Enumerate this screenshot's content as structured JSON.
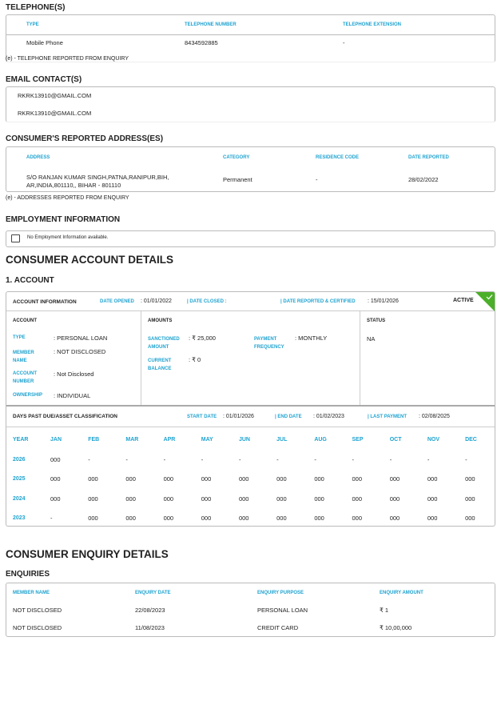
{
  "telephones": {
    "title": "TELEPHONE(S)",
    "headers": [
      "TYPE",
      "TELEPHONE NUMBER",
      "TELEPHONE EXTENSION"
    ],
    "rows": [
      [
        "Mobile Phone",
        "8434592885",
        "-"
      ]
    ],
    "note": "(e) - TELEPHONE REPORTED FROM ENQUIRY"
  },
  "emails": {
    "title": "EMAIL CONTACT(S)",
    "items": [
      "RKRK13910@GMAIL.COM",
      "RKRK13910@GMAIL.COM"
    ]
  },
  "addresses": {
    "title": "CONSUMER'S REPORTED ADDRESS(ES)",
    "headers": [
      "ADDRESS",
      "CATEGORY",
      "RESIDENCE CODE",
      "DATE REPORTED"
    ],
    "rows": [
      [
        "S/O RANJAN KUMAR SINGH,PATNA,RANIPUR,BIH, AR,INDIA,801110,, BIHAR - 801110",
        "Permanent",
        "-",
        "28/02/2022"
      ]
    ],
    "note": "(e) - ADDRESSES REPORTED FROM ENQUIRY"
  },
  "employment": {
    "title": "EMPLOYMENT INFORMATION",
    "message": "No Employment Information available.",
    "icon": "briefcase-info-icon"
  },
  "account_details": {
    "title": "CONSUMER ACCOUNT DETAILS",
    "account_title": "1. ACCOUNT",
    "info": {
      "label": "ACCOUNT INFORMATION",
      "date_opened_label": "DATE OPENED",
      "date_opened": ": 01/01/2022",
      "date_closed_label": "DATE CLOSED",
      "date_closed": ":",
      "date_reported_label": "DATE REPORTED & CERTIFIED",
      "date_reported": ": 15/01/2026",
      "status_badge": "ACTIVE",
      "badge_color": "#4caf2a"
    },
    "account": {
      "heading": "ACCOUNT",
      "type_label": "TYPE",
      "type": "PERSONAL LOAN",
      "member_label": "MEMBER NAME",
      "member": "NOT DISCLOSED",
      "number_label": "ACCOUNT NUMBER",
      "number": "Not Disclosed",
      "ownership_label": "OWNERSHIP",
      "ownership": "INDIVIDUAL"
    },
    "amounts": {
      "heading": "AMOUNTS",
      "sanctioned_label": "SANCTIONED AMOUNT",
      "sanctioned": "₹ 25,000",
      "frequency_label": "PAYMENT FREQUENCY",
      "frequency": "MONTHLY",
      "balance_label": "CURRENT BALANCE",
      "balance": "₹ 0"
    },
    "status": {
      "heading": "STATUS",
      "value": "NA"
    },
    "dpd": {
      "heading": "DAYS PAST DUE/ASSET CLASSIFICATION",
      "start_label": "START DATE",
      "start": ": 01/01/2026",
      "end_label": "END DATE",
      "end": ": 01/02/2023",
      "last_label": "LAST PAYMENT",
      "last": ": 02/08/2025",
      "columns": [
        "YEAR",
        "JAN",
        "FEB",
        "MAR",
        "APR",
        "MAY",
        "JUN",
        "JUL",
        "AUG",
        "SEP",
        "OCT",
        "NOV",
        "DEC"
      ],
      "rows": [
        [
          "2026",
          "000",
          "-",
          "-",
          "-",
          "-",
          "-",
          "-",
          "-",
          "-",
          "-",
          "-",
          "-"
        ],
        [
          "2025",
          "000",
          "000",
          "000",
          "000",
          "000",
          "000",
          "000",
          "000",
          "000",
          "000",
          "000",
          "000"
        ],
        [
          "2024",
          "000",
          "000",
          "000",
          "000",
          "000",
          "000",
          "000",
          "000",
          "000",
          "000",
          "000",
          "000"
        ],
        [
          "2023",
          "-",
          "000",
          "000",
          "000",
          "000",
          "000",
          "000",
          "000",
          "000",
          "000",
          "000",
          "000"
        ]
      ]
    }
  },
  "enquiry_details": {
    "title": "CONSUMER ENQUIRY DETAILS",
    "subtitle": "ENQUIRIES",
    "headers": [
      "MEMBER NAME",
      "ENQUIRY DATE",
      "ENQUIRY PURPOSE",
      "ENQUIRY AMOUNT"
    ],
    "rows": [
      [
        "NOT DISCLOSED",
        "22/08/2023",
        "PERSONAL LOAN",
        "₹ 1"
      ],
      [
        "NOT DISCLOSED",
        "11/08/2023",
        "CREDIT CARD",
        "₹ 10,00,000"
      ]
    ]
  }
}
